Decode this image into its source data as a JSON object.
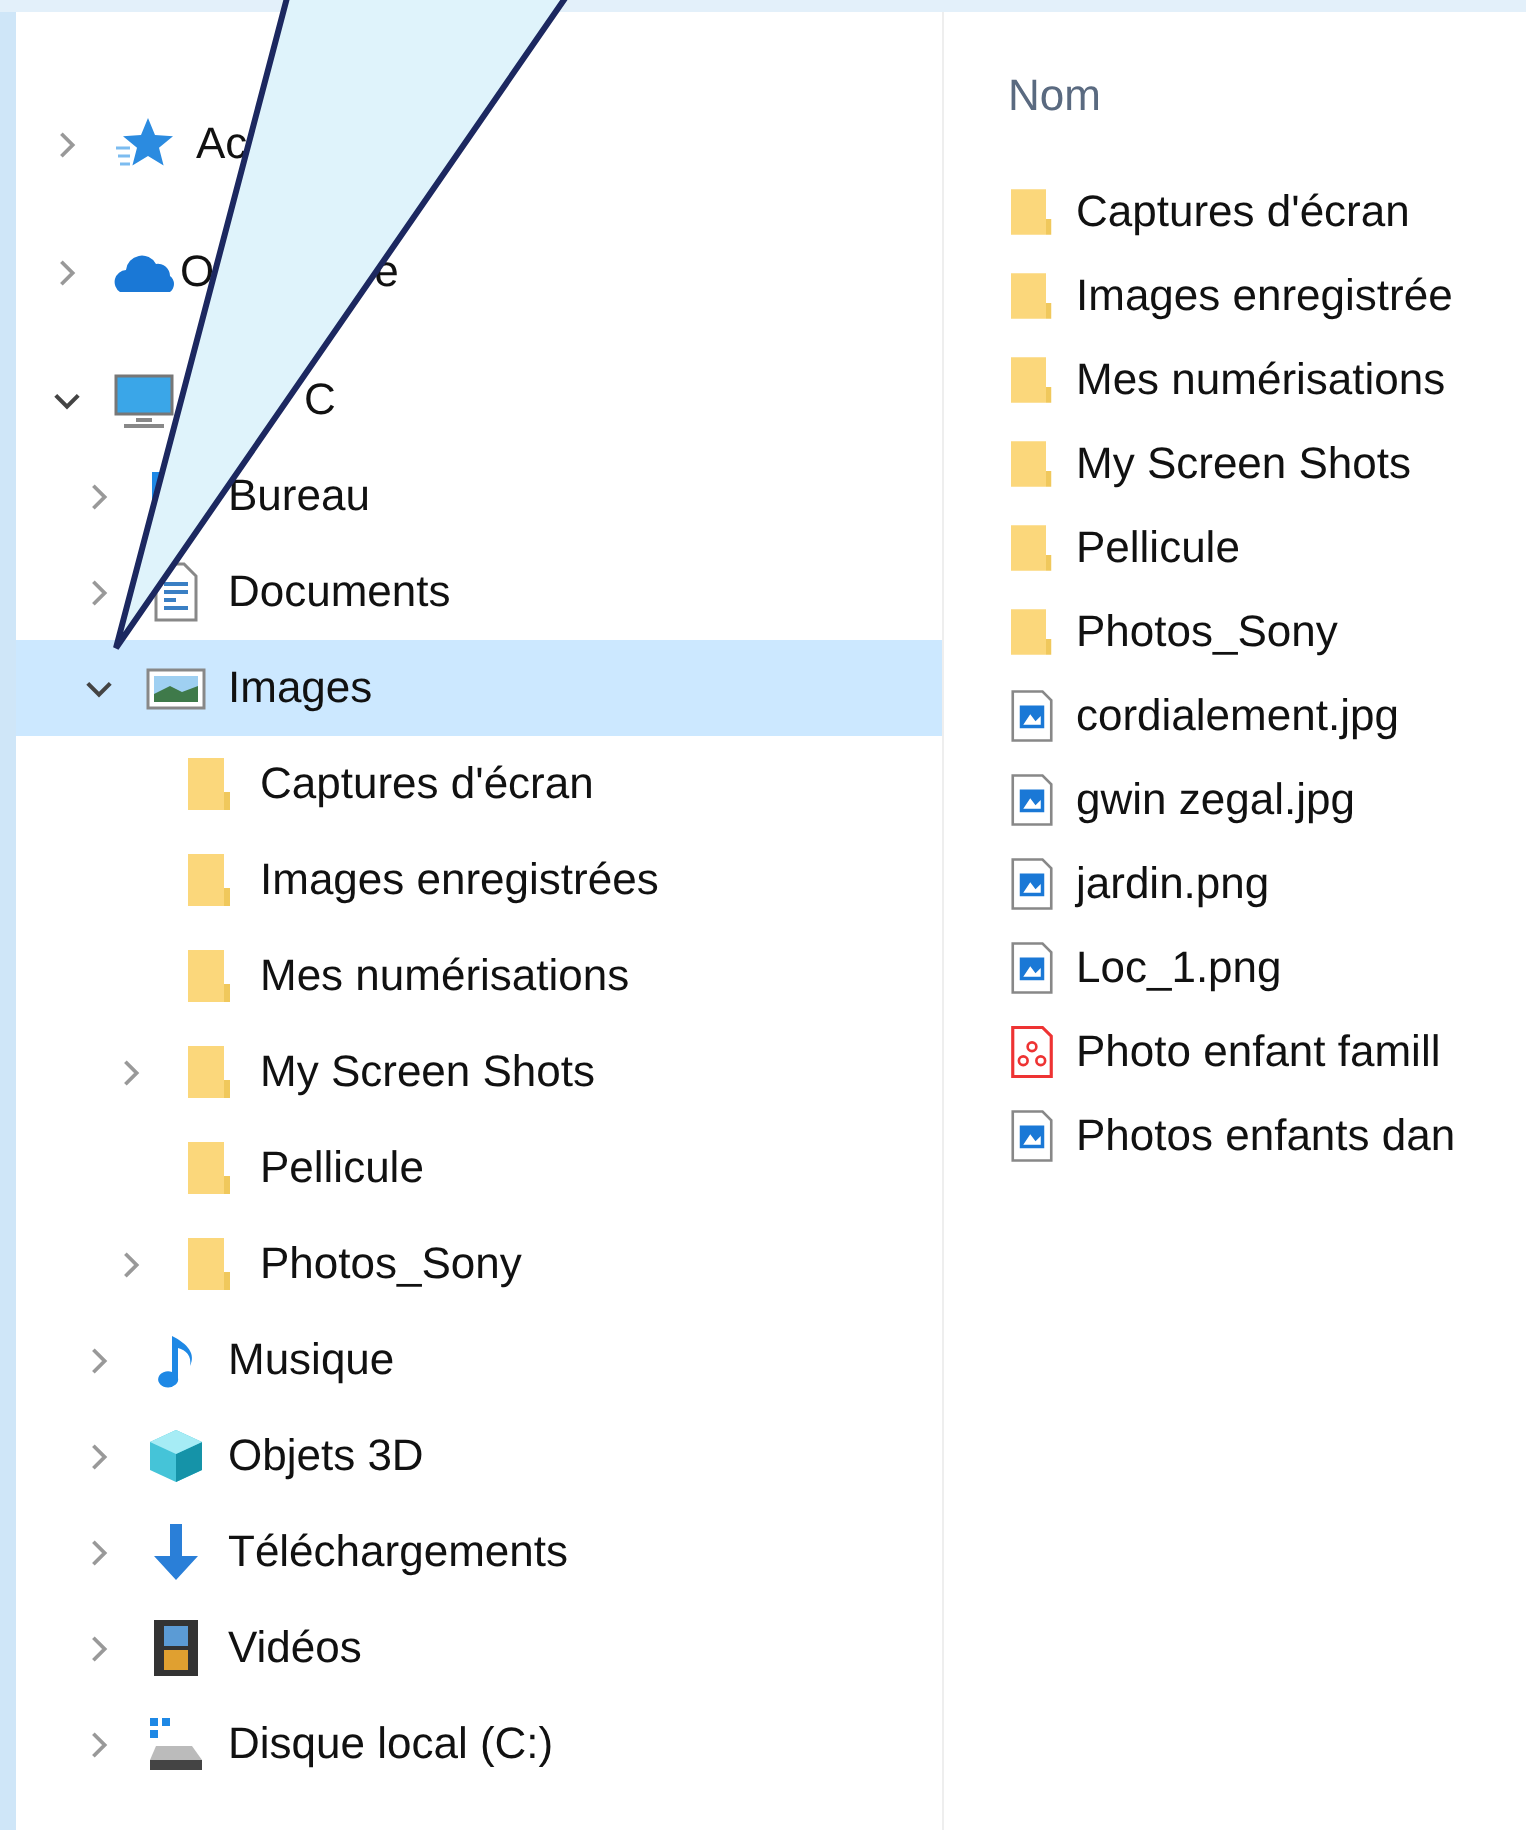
{
  "nav": [
    {
      "label": "Ac",
      "kind": "star",
      "expanded": false,
      "selected": false
    },
    {
      "label": "O",
      "label_tail": "e",
      "kind": "cloud",
      "expanded": false,
      "selected": false
    },
    {
      "label_tail": "C",
      "kind": "monitor",
      "expanded": true,
      "selected": false,
      "children": [
        {
          "label": "Bureau",
          "kind": "desktop",
          "expanded": false,
          "selected": false
        },
        {
          "label": "Documents",
          "kind": "document",
          "expanded": false,
          "selected": false
        },
        {
          "label": "Images",
          "kind": "pictures",
          "expanded": true,
          "selected": true,
          "children": [
            {
              "label": "Captures d'écran",
              "kind": "folder",
              "selected": false
            },
            {
              "label": "Images enregistrées",
              "kind": "folder",
              "selected": false
            },
            {
              "label": "Mes numérisations",
              "kind": "folder",
              "selected": false
            },
            {
              "label": "My Screen Shots",
              "kind": "folder",
              "expanded": false,
              "selected": false
            },
            {
              "label": "Pellicule",
              "kind": "folder",
              "selected": false
            },
            {
              "label": "Photos_Sony",
              "kind": "folder",
              "expanded": false,
              "selected": false
            }
          ]
        },
        {
          "label": "Musique",
          "kind": "music",
          "expanded": false,
          "selected": false
        },
        {
          "label": "Objets 3D",
          "kind": "cube",
          "expanded": false,
          "selected": false
        },
        {
          "label": "Téléchargements",
          "kind": "download",
          "expanded": false,
          "selected": false
        },
        {
          "label": "Vidéos",
          "kind": "film",
          "expanded": false,
          "selected": false
        },
        {
          "label": "Disque local (C:)",
          "kind": "drive",
          "expanded": false,
          "selected": false
        }
      ]
    }
  ],
  "files": {
    "column": "Nom",
    "items": [
      {
        "name": "Captures d'écran",
        "kind": "folder"
      },
      {
        "name": "Images enregistrée",
        "kind": "folder"
      },
      {
        "name": "Mes numérisations",
        "kind": "folder"
      },
      {
        "name": "My Screen Shots",
        "kind": "folder"
      },
      {
        "name": "Pellicule",
        "kind": "folder"
      },
      {
        "name": "Photos_Sony",
        "kind": "folder"
      },
      {
        "name": "cordialement.jpg",
        "kind": "image"
      },
      {
        "name": "gwin zegal.jpg",
        "kind": "image"
      },
      {
        "name": "jardin.png",
        "kind": "image"
      },
      {
        "name": "Loc_1.png",
        "kind": "image"
      },
      {
        "name": "Photo enfant famill",
        "kind": "pdf"
      },
      {
        "name": "Photos enfants dan",
        "kind": "image"
      }
    ]
  }
}
